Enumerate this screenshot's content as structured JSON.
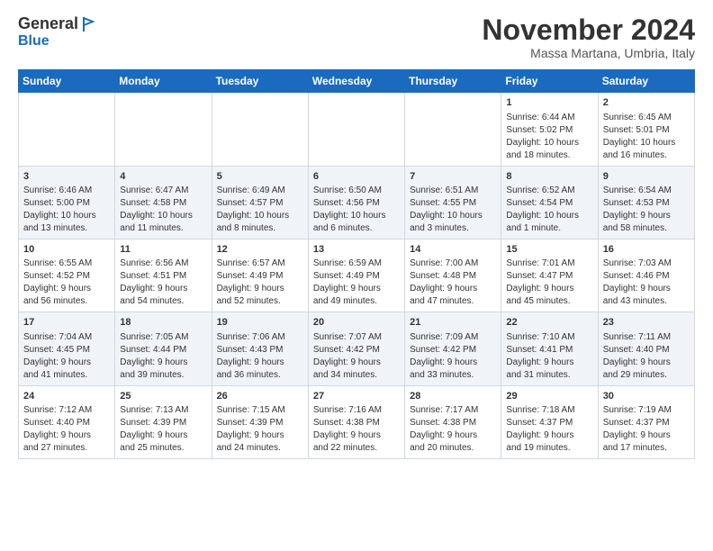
{
  "logo": {
    "general": "General",
    "blue": "Blue"
  },
  "header": {
    "month": "November 2024",
    "location": "Massa Martana, Umbria, Italy"
  },
  "weekdays": [
    "Sunday",
    "Monday",
    "Tuesday",
    "Wednesday",
    "Thursday",
    "Friday",
    "Saturday"
  ],
  "rows": [
    [
      {
        "day": "",
        "info": ""
      },
      {
        "day": "",
        "info": ""
      },
      {
        "day": "",
        "info": ""
      },
      {
        "day": "",
        "info": ""
      },
      {
        "day": "",
        "info": ""
      },
      {
        "day": "1",
        "info": "Sunrise: 6:44 AM\nSunset: 5:02 PM\nDaylight: 10 hours\nand 18 minutes."
      },
      {
        "day": "2",
        "info": "Sunrise: 6:45 AM\nSunset: 5:01 PM\nDaylight: 10 hours\nand 16 minutes."
      }
    ],
    [
      {
        "day": "3",
        "info": "Sunrise: 6:46 AM\nSunset: 5:00 PM\nDaylight: 10 hours\nand 13 minutes."
      },
      {
        "day": "4",
        "info": "Sunrise: 6:47 AM\nSunset: 4:58 PM\nDaylight: 10 hours\nand 11 minutes."
      },
      {
        "day": "5",
        "info": "Sunrise: 6:49 AM\nSunset: 4:57 PM\nDaylight: 10 hours\nand 8 minutes."
      },
      {
        "day": "6",
        "info": "Sunrise: 6:50 AM\nSunset: 4:56 PM\nDaylight: 10 hours\nand 6 minutes."
      },
      {
        "day": "7",
        "info": "Sunrise: 6:51 AM\nSunset: 4:55 PM\nDaylight: 10 hours\nand 3 minutes."
      },
      {
        "day": "8",
        "info": "Sunrise: 6:52 AM\nSunset: 4:54 PM\nDaylight: 10 hours\nand 1 minute."
      },
      {
        "day": "9",
        "info": "Sunrise: 6:54 AM\nSunset: 4:53 PM\nDaylight: 9 hours\nand 58 minutes."
      }
    ],
    [
      {
        "day": "10",
        "info": "Sunrise: 6:55 AM\nSunset: 4:52 PM\nDaylight: 9 hours\nand 56 minutes."
      },
      {
        "day": "11",
        "info": "Sunrise: 6:56 AM\nSunset: 4:51 PM\nDaylight: 9 hours\nand 54 minutes."
      },
      {
        "day": "12",
        "info": "Sunrise: 6:57 AM\nSunset: 4:49 PM\nDaylight: 9 hours\nand 52 minutes."
      },
      {
        "day": "13",
        "info": "Sunrise: 6:59 AM\nSunset: 4:49 PM\nDaylight: 9 hours\nand 49 minutes."
      },
      {
        "day": "14",
        "info": "Sunrise: 7:00 AM\nSunset: 4:48 PM\nDaylight: 9 hours\nand 47 minutes."
      },
      {
        "day": "15",
        "info": "Sunrise: 7:01 AM\nSunset: 4:47 PM\nDaylight: 9 hours\nand 45 minutes."
      },
      {
        "day": "16",
        "info": "Sunrise: 7:03 AM\nSunset: 4:46 PM\nDaylight: 9 hours\nand 43 minutes."
      }
    ],
    [
      {
        "day": "17",
        "info": "Sunrise: 7:04 AM\nSunset: 4:45 PM\nDaylight: 9 hours\nand 41 minutes."
      },
      {
        "day": "18",
        "info": "Sunrise: 7:05 AM\nSunset: 4:44 PM\nDaylight: 9 hours\nand 39 minutes."
      },
      {
        "day": "19",
        "info": "Sunrise: 7:06 AM\nSunset: 4:43 PM\nDaylight: 9 hours\nand 36 minutes."
      },
      {
        "day": "20",
        "info": "Sunrise: 7:07 AM\nSunset: 4:42 PM\nDaylight: 9 hours\nand 34 minutes."
      },
      {
        "day": "21",
        "info": "Sunrise: 7:09 AM\nSunset: 4:42 PM\nDaylight: 9 hours\nand 33 minutes."
      },
      {
        "day": "22",
        "info": "Sunrise: 7:10 AM\nSunset: 4:41 PM\nDaylight: 9 hours\nand 31 minutes."
      },
      {
        "day": "23",
        "info": "Sunrise: 7:11 AM\nSunset: 4:40 PM\nDaylight: 9 hours\nand 29 minutes."
      }
    ],
    [
      {
        "day": "24",
        "info": "Sunrise: 7:12 AM\nSunset: 4:40 PM\nDaylight: 9 hours\nand 27 minutes."
      },
      {
        "day": "25",
        "info": "Sunrise: 7:13 AM\nSunset: 4:39 PM\nDaylight: 9 hours\nand 25 minutes."
      },
      {
        "day": "26",
        "info": "Sunrise: 7:15 AM\nSunset: 4:39 PM\nDaylight: 9 hours\nand 24 minutes."
      },
      {
        "day": "27",
        "info": "Sunrise: 7:16 AM\nSunset: 4:38 PM\nDaylight: 9 hours\nand 22 minutes."
      },
      {
        "day": "28",
        "info": "Sunrise: 7:17 AM\nSunset: 4:38 PM\nDaylight: 9 hours\nand 20 minutes."
      },
      {
        "day": "29",
        "info": "Sunrise: 7:18 AM\nSunset: 4:37 PM\nDaylight: 9 hours\nand 19 minutes."
      },
      {
        "day": "30",
        "info": "Sunrise: 7:19 AM\nSunset: 4:37 PM\nDaylight: 9 hours\nand 17 minutes."
      }
    ]
  ]
}
